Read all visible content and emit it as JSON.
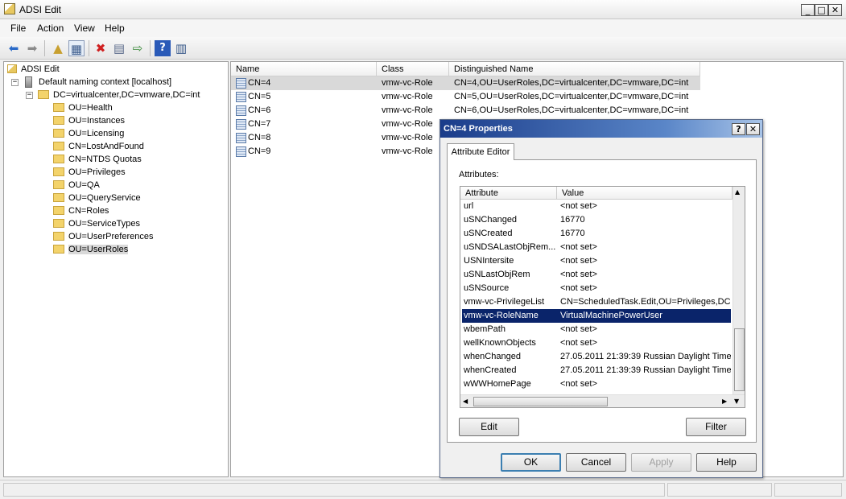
{
  "window": {
    "title": "ADSI Edit"
  },
  "menu": [
    "File",
    "Action",
    "View",
    "Help"
  ],
  "toolbar": {
    "icons": [
      "back-arrow-icon",
      "forward-arrow-icon",
      "up-folder-icon",
      "show-hide-tree-icon",
      "delete-icon",
      "properties-icon",
      "export-list-icon",
      "help-icon",
      "show-hide-action-pane-icon"
    ],
    "colors": {
      "accent": "#0a246a",
      "delete": "#d02020"
    }
  },
  "tree": {
    "root": "ADSI Edit",
    "context": "Default naming context [localhost]",
    "domain": "DC=virtualcenter,DC=vmware,DC=int",
    "children": [
      "OU=Health",
      "OU=Instances",
      "OU=Licensing",
      "CN=LostAndFound",
      "CN=NTDS Quotas",
      "OU=Privileges",
      "OU=QA",
      "OU=QueryService",
      "CN=Roles",
      "OU=ServiceTypes",
      "OU=UserPreferences",
      "OU=UserRoles"
    ],
    "selected": "OU=UserRoles"
  },
  "list": {
    "headers": [
      "Name",
      "Class",
      "Distinguished Name"
    ],
    "rows": [
      {
        "name": "CN=4",
        "class": "vmw-vc-Role",
        "dn": "CN=4,OU=UserRoles,DC=virtualcenter,DC=vmware,DC=int"
      },
      {
        "name": "CN=5",
        "class": "vmw-vc-Role",
        "dn": "CN=5,OU=UserRoles,DC=virtualcenter,DC=vmware,DC=int"
      },
      {
        "name": "CN=6",
        "class": "vmw-vc-Role",
        "dn": "CN=6,OU=UserRoles,DC=virtualcenter,DC=vmware,DC=int"
      },
      {
        "name": "CN=7",
        "class": "vmw-vc-Role",
        "dn": ""
      },
      {
        "name": "CN=8",
        "class": "vmw-vc-Role",
        "dn": ""
      },
      {
        "name": "CN=9",
        "class": "vmw-vc-Role",
        "dn": ""
      }
    ]
  },
  "dialog": {
    "title": "CN=4 Properties",
    "help_btn": "?",
    "close_btn": "✕",
    "tab": "Attribute Editor",
    "attributes_label": "Attributes:",
    "grid_headers": [
      "Attribute",
      "Value"
    ],
    "rows": [
      {
        "attr": "url",
        "value": "<not set>"
      },
      {
        "attr": "uSNChanged",
        "value": "16770"
      },
      {
        "attr": "uSNCreated",
        "value": "16770"
      },
      {
        "attr": "uSNDSALastObjRem...",
        "value": "<not set>"
      },
      {
        "attr": "USNIntersite",
        "value": "<not set>"
      },
      {
        "attr": "uSNLastObjRem",
        "value": "<not set>"
      },
      {
        "attr": "uSNSource",
        "value": "<not set>"
      },
      {
        "attr": "vmw-vc-PrivilegeList",
        "value": "CN=ScheduledTask.Edit,OU=Privileges,DC="
      },
      {
        "attr": "vmw-vc-RoleName",
        "value": "VirtualMachinePowerUser"
      },
      {
        "attr": "wbemPath",
        "value": "<not set>"
      },
      {
        "attr": "wellKnownObjects",
        "value": "<not set>"
      },
      {
        "attr": "whenChanged",
        "value": "27.05.2011 21:39:39 Russian Daylight Time"
      },
      {
        "attr": "whenCreated",
        "value": "27.05.2011 21:39:39 Russian Daylight Time"
      },
      {
        "attr": "wWWHomePage",
        "value": "<not set>"
      }
    ],
    "selected_row": "vmw-vc-RoleName",
    "edit_btn": "Edit",
    "filter_btn": "Filter",
    "ok_btn": "OK",
    "cancel_btn": "Cancel",
    "apply_btn": "Apply",
    "help_button": "Help"
  }
}
